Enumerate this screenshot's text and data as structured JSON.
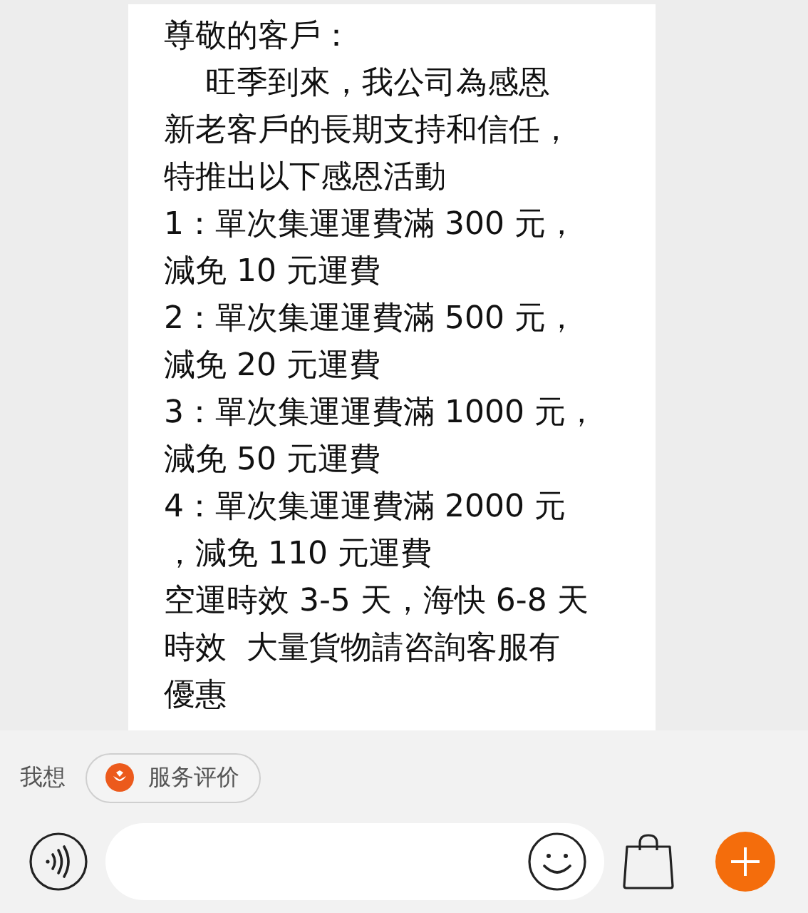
{
  "message": {
    "lines": [
      "尊敬的客戶：",
      "　 旺季到來，我公司為感恩",
      "新老客戶的長期支持和信任，",
      "特推出以下感恩活動",
      "1：單次集運運費滿 300 元，",
      "減免 10 元運費",
      "2：單次集運運費滿 500 元，",
      "減免 20 元運費",
      "3：單次集運運費滿 1000 元，",
      "減免 50 元運費",
      "4：單次集運運費滿 2000 元",
      "，減免 110 元運費",
      "空運時效 3-5 天，海快 6-8 天",
      "時效  大量貨物請咨詢客服有",
      "優惠"
    ]
  },
  "quick_replies": {
    "label": "我想",
    "chips": [
      "服务评价"
    ]
  }
}
